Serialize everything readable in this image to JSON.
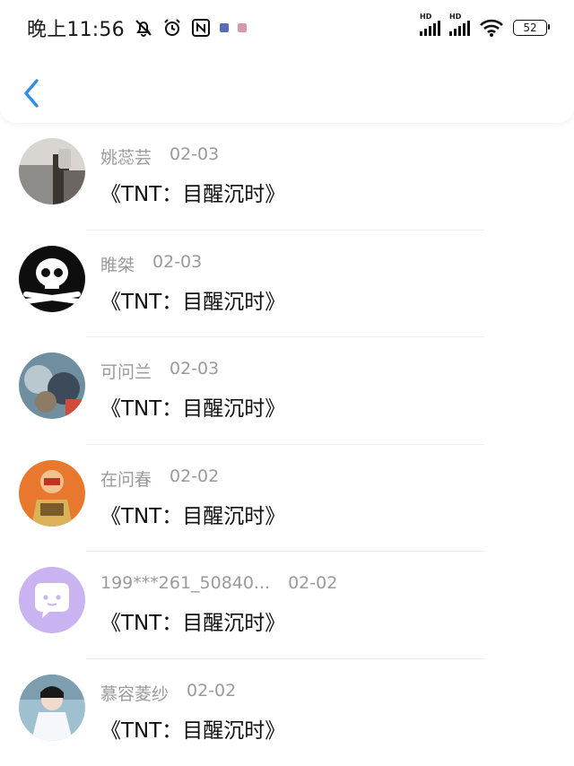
{
  "status_bar": {
    "time": "晚上11:56",
    "battery": "52"
  },
  "header": {
    "back_label": ""
  },
  "comments": [
    {
      "name": "姚蕊芸",
      "date": "02-03",
      "text": "《TNT：目醒沉时》"
    },
    {
      "name": "睢桀",
      "date": "02-03",
      "text": "《TNT：目醒沉时》"
    },
    {
      "name": "可问兰",
      "date": "02-03",
      "text": "《TNT：目醒沉时》"
    },
    {
      "name": "在问春",
      "date": "02-02",
      "text": "《TNT：目醒沉时》"
    },
    {
      "name": "199***261_50840...",
      "date": "02-02",
      "text": "《TNT：目醒沉时》"
    },
    {
      "name": "慕容菱纱",
      "date": "02-02",
      "text": "《TNT：目醒沉时》"
    }
  ],
  "colors": {
    "accent": "#2f8fe6",
    "name_gray": "#9a9a9a",
    "avatar_purple": "#c9b3f0"
  }
}
